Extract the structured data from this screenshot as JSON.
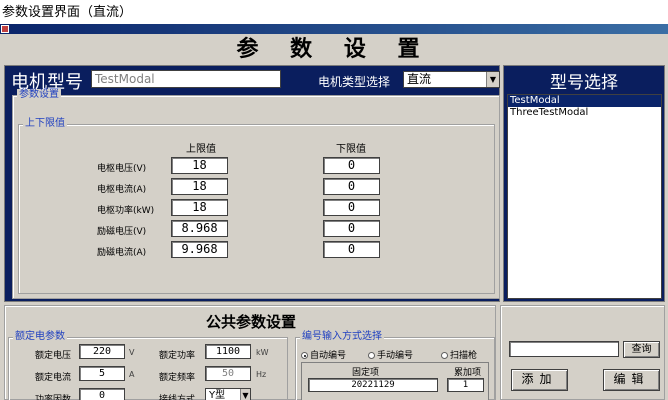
{
  "caption": "参数设置界面（直流）",
  "header_title": "参 数 设 置",
  "motor": {
    "label": "电机型号",
    "value": "TestModal"
  },
  "motor_type": {
    "label": "电机类型选择",
    "value": "直流"
  },
  "model_select": {
    "title": "型号选择",
    "items": [
      "TestModal",
      "ThreeTestModal"
    ],
    "selected_index": 0
  },
  "params": {
    "group_label": "参数设置",
    "limits_label": "上下限值",
    "upper_header": "上限值",
    "lower_header": "下限值",
    "rows": [
      {
        "label": "电枢电压(V)",
        "upper": "18",
        "lower": "0"
      },
      {
        "label": "电枢电流(A)",
        "upper": "18",
        "lower": "0"
      },
      {
        "label": "电枢功率(kW)",
        "upper": "18",
        "lower": "0"
      },
      {
        "label": "励磁电压(V)",
        "upper": "8.968",
        "lower": "0"
      },
      {
        "label": "励磁电流(A)",
        "upper": "9.968",
        "lower": "0"
      }
    ]
  },
  "public": {
    "title": "公共参数设置",
    "rated_label": "额定电参数",
    "rated_voltage": {
      "label": "额定电压",
      "value": "220",
      "unit": "V"
    },
    "rated_current": {
      "label": "额定电流",
      "value": "5",
      "unit": "A"
    },
    "power_factor": {
      "label": "功率因数",
      "value": "0"
    },
    "rated_power": {
      "label": "额定功率",
      "value": "1100",
      "unit": "kW"
    },
    "rated_freq": {
      "label": "额定频率",
      "value": "50",
      "unit": "Hz"
    },
    "wiring": {
      "label": "接线方式",
      "value": "Y型"
    }
  },
  "code": {
    "group_label": "编号输入方式选择",
    "options": [
      "自动编号",
      "手动编号",
      "扫描枪"
    ],
    "selected_index": 0,
    "fixed_label": "固定项",
    "fixed_value": "20221129",
    "incr_label": "累加项",
    "incr_value": "1"
  },
  "actions": {
    "search_label": "查询",
    "add_label": "添加",
    "edit_label": "编辑"
  }
}
